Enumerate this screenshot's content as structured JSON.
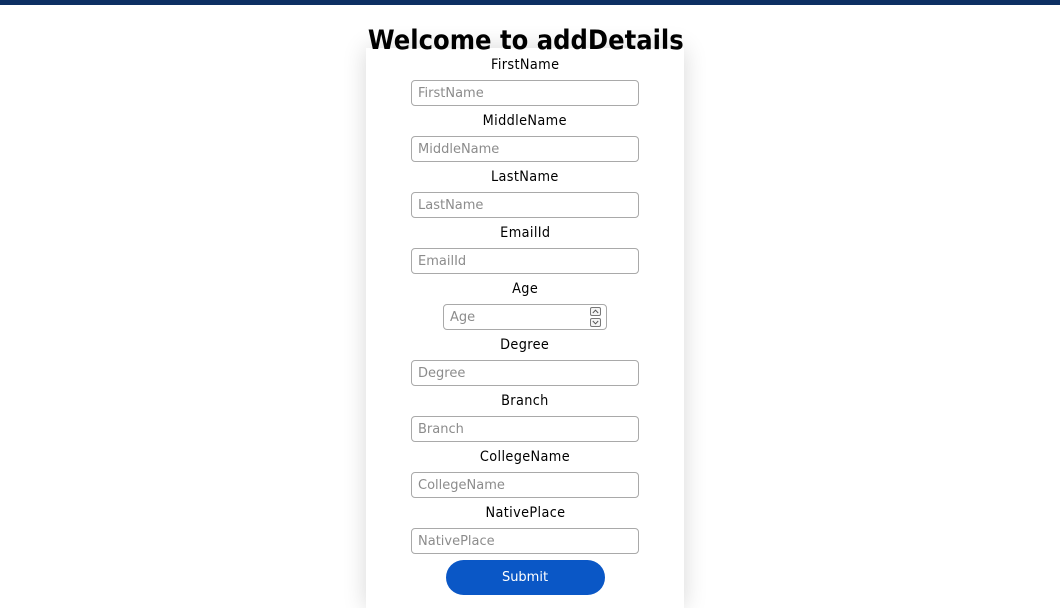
{
  "page": {
    "title": "Welcome to addDetails"
  },
  "colors": {
    "top_bar": "#0d2f63",
    "submit_button": "#0a57c6"
  },
  "form": {
    "fields": {
      "first_name": {
        "label": "FirstName",
        "placeholder": "FirstName",
        "value": ""
      },
      "middle_name": {
        "label": "MiddleName",
        "placeholder": "MiddleName",
        "value": ""
      },
      "last_name": {
        "label": "LastName",
        "placeholder": "LastName",
        "value": ""
      },
      "email_id": {
        "label": "EmailId",
        "placeholder": "EmailId",
        "value": ""
      },
      "age": {
        "label": "Age",
        "placeholder": "Age",
        "value": ""
      },
      "degree": {
        "label": "Degree",
        "placeholder": "Degree",
        "value": ""
      },
      "branch": {
        "label": "Branch",
        "placeholder": "Branch",
        "value": ""
      },
      "college_name": {
        "label": "CollegeName",
        "placeholder": "CollegeName",
        "value": ""
      },
      "native_place": {
        "label": "NativePlace",
        "placeholder": "NativePlace",
        "value": ""
      }
    },
    "submit_label": "Submit"
  },
  "icons": {
    "age_increment": "chevron-up-icon",
    "age_decrement": "chevron-down-icon"
  }
}
